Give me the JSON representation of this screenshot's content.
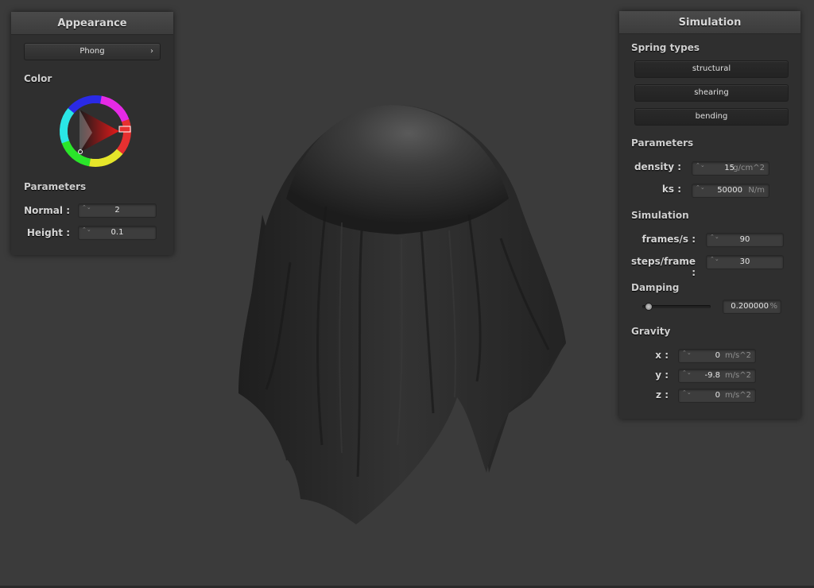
{
  "colors": {
    "background": "#3b3b3b",
    "panel": "#2f2f2f",
    "cloth": "#2c2c2c"
  },
  "appearance": {
    "title": "Appearance",
    "shader_button": "Phong",
    "shader_chevron": "›",
    "color_label": "Color",
    "parameters_label": "Parameters",
    "normal_label": "Normal :",
    "normal_value": "2",
    "height_label": "Height :",
    "height_value": "0.1",
    "spinner_glyph": "⌃⌄"
  },
  "simulation": {
    "title": "Simulation",
    "spring_types_label": "Spring types",
    "spring_buttons": [
      "structural",
      "shearing",
      "bending"
    ],
    "parameters_label": "Parameters",
    "density_label": "density :",
    "density_value": "15",
    "density_unit": "g/cm^2",
    "ks_label": "ks :",
    "ks_value": "50000",
    "ks_unit": "N/m",
    "simulation_label": "Simulation",
    "fps_label": "frames/s :",
    "fps_value": "90",
    "steps_label": "steps/frame :",
    "steps_value": "30",
    "damping_label": "Damping",
    "damping_value": "0.200000",
    "damping_unit": "%",
    "damping_slider_fraction": 0.2,
    "gravity_label": "Gravity",
    "gx_label": "x :",
    "gx_value": "0",
    "gy_label": "y :",
    "gy_value": "-9.8",
    "gz_label": "z :",
    "gz_value": "0",
    "gravity_unit": "m/s^2"
  }
}
